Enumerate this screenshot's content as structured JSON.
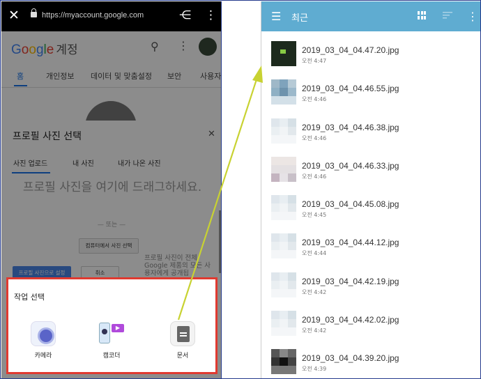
{
  "browser": {
    "url": "https://myaccount.google.com"
  },
  "google": {
    "logo": "Google",
    "logo_suffix": "계정",
    "tabs": [
      "홈",
      "개인정보",
      "데이터 및 맞춤설정",
      "보안",
      "사용자"
    ]
  },
  "dialog": {
    "title": "프로필 사진 선택",
    "tabs": [
      "사진 업로드",
      "내 사진",
      "내가 나온 사진"
    ],
    "drag_text": "프로필 사진을 여기에 드래그하세요.",
    "or_text": "— 또는 —",
    "pick_button": "컴퓨터에서 사진 선택",
    "set_button": "프로필 사진으로 설정",
    "cancel_button": "취소",
    "policy_text": "프로필 사진이 전체 Google 제품의 모든 사용자에게 공개됩"
  },
  "sheet": {
    "title": "작업 선택",
    "apps": [
      {
        "label": "카메라",
        "icon": "camera-icon"
      },
      {
        "label": "캠코더",
        "icon": "camcorder-icon"
      },
      {
        "label": "문서",
        "icon": "document-icon"
      }
    ]
  },
  "files": {
    "title": "최근",
    "items": [
      {
        "name": "2019_03_04_04.47.20.jpg",
        "time": "오전 4:47"
      },
      {
        "name": "2019_03_04_04.46.55.jpg",
        "time": "오전 4:46"
      },
      {
        "name": "2019_03_04_04.46.38.jpg",
        "time": "오전 4:46"
      },
      {
        "name": "2019_03_04_04.46.33.jpg",
        "time": "오전 4:46"
      },
      {
        "name": "2019_03_04_04.45.08.jpg",
        "time": "오전 4:45"
      },
      {
        "name": "2019_03_04_04.44.12.jpg",
        "time": "오전 4:44"
      },
      {
        "name": "2019_03_04_04.42.19.jpg",
        "time": "오전 4:42"
      },
      {
        "name": "2019_03_04_04.42.02.jpg",
        "time": "오전 4:42"
      },
      {
        "name": "2019_03_04_04.39.20.jpg",
        "time": "오전 4:39"
      }
    ]
  },
  "colors": {
    "accent_red": "#e03a30",
    "files_bar": "#5facd1",
    "arrow": "#c8d232",
    "google_blue": "#1a73e8"
  }
}
